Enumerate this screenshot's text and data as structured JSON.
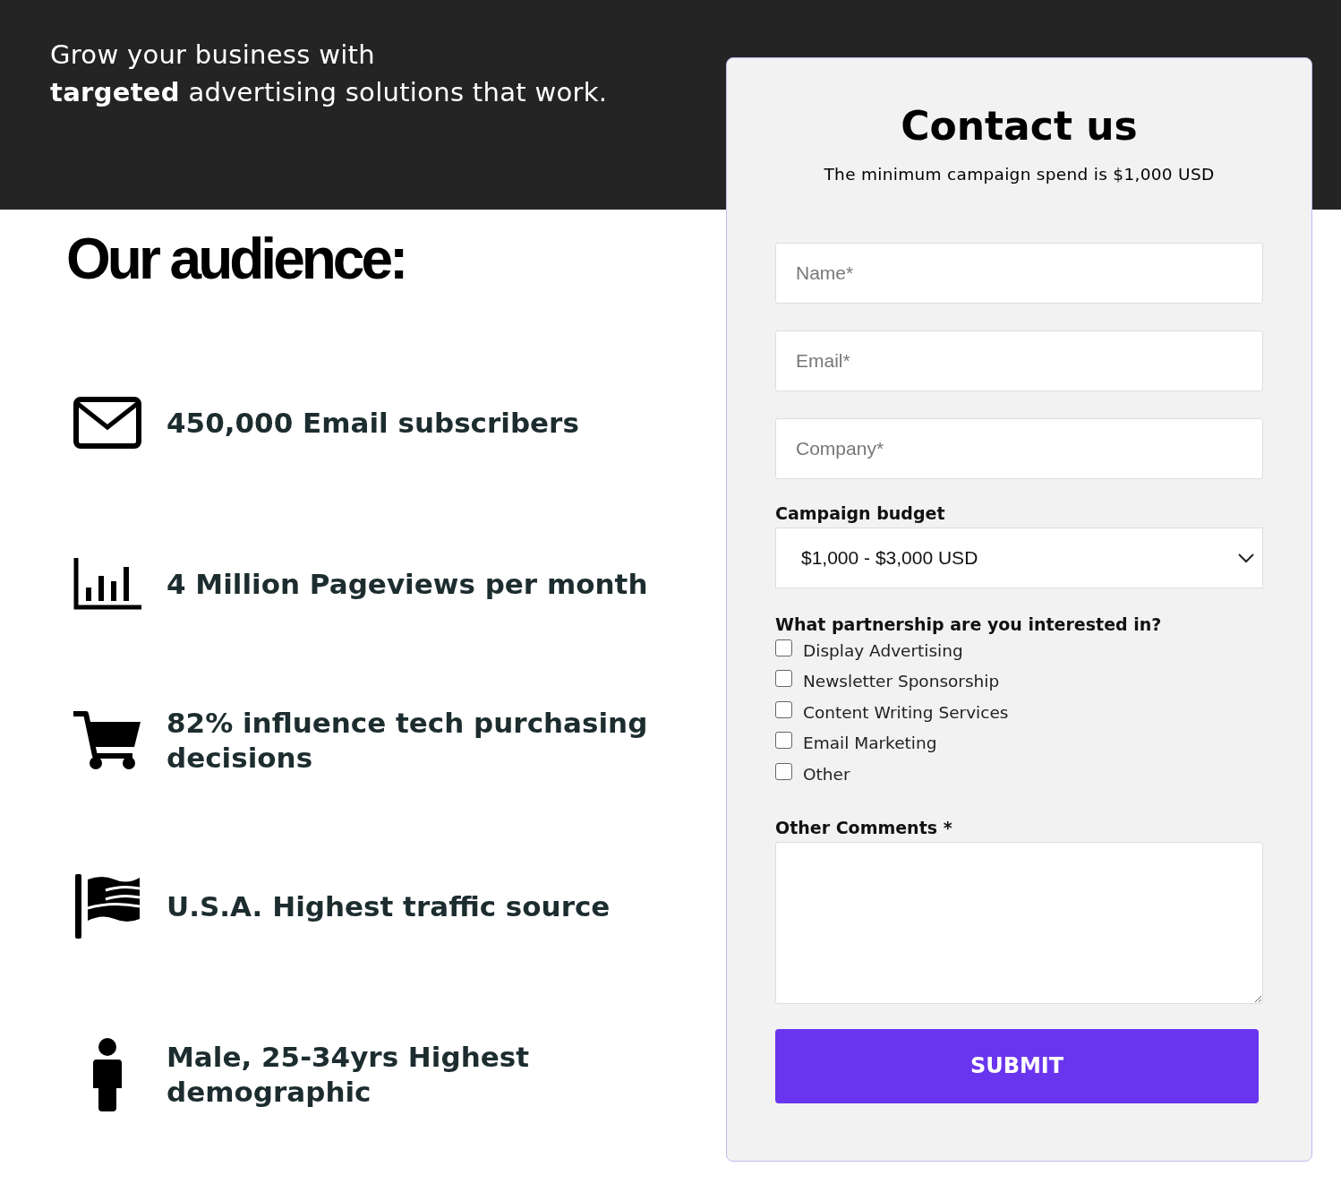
{
  "hero": {
    "line1": "Grow your business with",
    "line2": "**targeted** advertising solutions that work."
  },
  "audience": {
    "title": "Our audience:",
    "items": [
      {
        "kind": "envelope",
        "text": "450,000 Email subscribers"
      },
      {
        "kind": "chart",
        "text": "4 Million Pageviews per month"
      },
      {
        "kind": "cart",
        "text": "82% influence tech purchasing decisions"
      },
      {
        "kind": "flag",
        "text": "U.S.A. Highest traffic source"
      },
      {
        "kind": "person",
        "text": "Male, 25-34yrs Highest demographic"
      }
    ]
  },
  "contact": {
    "title": "Contact us",
    "subtitle": "The minimum campaign spend is $1,000 USD",
    "fields": [
      {
        "placeholder": "Name*"
      },
      {
        "placeholder": "Email*"
      },
      {
        "placeholder": "Company*"
      }
    ],
    "budget": {
      "label": "Campaign budget",
      "value": "$1,000 - $3,000 USD"
    },
    "partnership": {
      "question": "What partnership are you interested in?",
      "options": [
        {
          "label": "Display Advertising",
          "checked": false
        },
        {
          "label": "Newsletter Sponsorship",
          "checked": false
        },
        {
          "label": "Content Writing Services",
          "checked": false
        },
        {
          "label": "Email Marketing",
          "checked": false
        },
        {
          "label": "Other",
          "checked": false
        }
      ]
    },
    "comments": {
      "label": "Other Comments *"
    },
    "submit": "SUBMIT"
  }
}
